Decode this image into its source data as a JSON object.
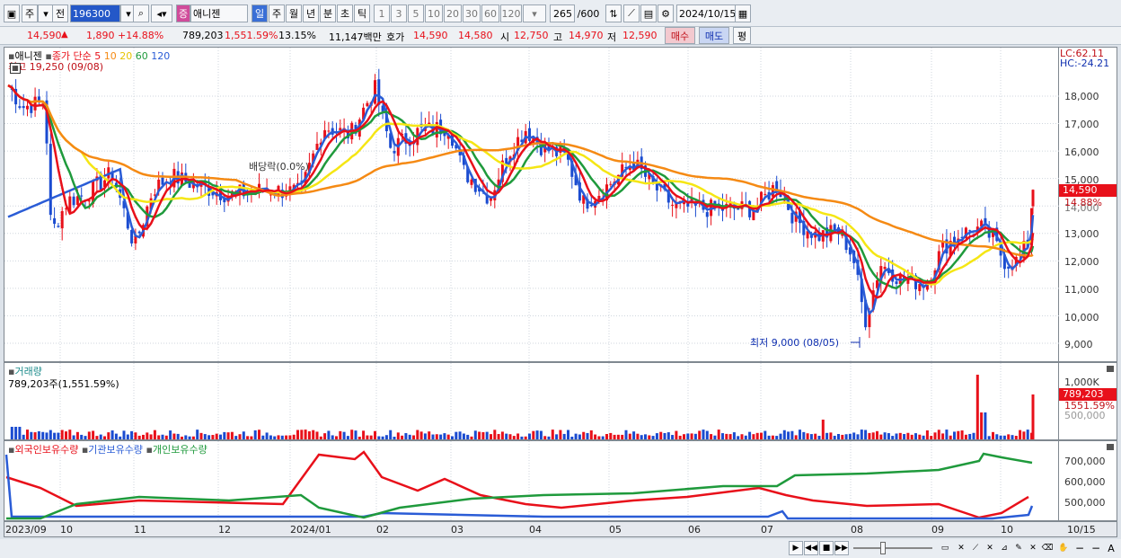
{
  "toolbar": {
    "tab_stock": "주",
    "tab_prev": "전",
    "code": "196300",
    "name": "애니젠",
    "periods": [
      "일",
      "주",
      "월",
      "년",
      "분",
      "초",
      "틱"
    ],
    "intervals": [
      "1",
      "3",
      "5",
      "10",
      "20",
      "30",
      "60",
      "120"
    ],
    "count": "265",
    "count_total": "/600",
    "date": "2024/10/15"
  },
  "infobar": {
    "price": "14,590",
    "price_arrow": "▲",
    "change": "1,890",
    "change_pct": "+14.88%",
    "volume": "789,203",
    "volume_pct": "1,551.59%",
    "turnover": "13.15%",
    "amount": "11,147백만",
    "hoga_label": "호가",
    "ask": "14,590",
    "bid": "14,580",
    "open_label": "시",
    "open": "12,750",
    "high_label": "고",
    "high": "14,970",
    "low_label": "저",
    "low": "12,590",
    "buy": "매수",
    "sell": "매도",
    "avg": "평"
  },
  "price_pane": {
    "title": "애니젠",
    "ma_label": "종가 단순",
    "ma_periods": [
      "5",
      "10",
      "20",
      "60",
      "120"
    ],
    "ma_colors": [
      "#e8101a",
      "#f58a14",
      "#f5e614",
      "#1f9a3c",
      "#2a5cd6"
    ],
    "high_note": "최고 19,250 (09/08)",
    "low_note": "최저 9,000 (08/05)",
    "dividend_note": "배당락(0.0%)",
    "lc": "LC:62.11",
    "hc": "HC:-24.21",
    "current_price": "14,590",
    "current_pct": "14.88%",
    "y_ticks": [
      "18,000",
      "17,000",
      "16,000",
      "15,000",
      "14,000",
      "13,000",
      "12,000",
      "11,000",
      "10,000",
      "9,000"
    ]
  },
  "volume_pane": {
    "title": "거래량",
    "value_text": "789,203주(1,551.59%)",
    "y_ticks": [
      "1,000K",
      "500,000"
    ],
    "current": "789,203",
    "current_pct": "1551.59%"
  },
  "holding_pane": {
    "series": [
      "외국인보유수량",
      "기관보유수량",
      "개인보유수량"
    ],
    "colors": [
      "#e8101a",
      "#2a5cd6",
      "#1f9a3c"
    ],
    "y_ticks": [
      "700,000",
      "600,000",
      "500,000"
    ]
  },
  "x_axis": {
    "labels": [
      "2023/09",
      "10",
      "11",
      "12",
      "2024/01",
      "02",
      "03",
      "04",
      "05",
      "06",
      "07",
      "08",
      "09",
      "10"
    ],
    "end_label": "10/15"
  }
}
